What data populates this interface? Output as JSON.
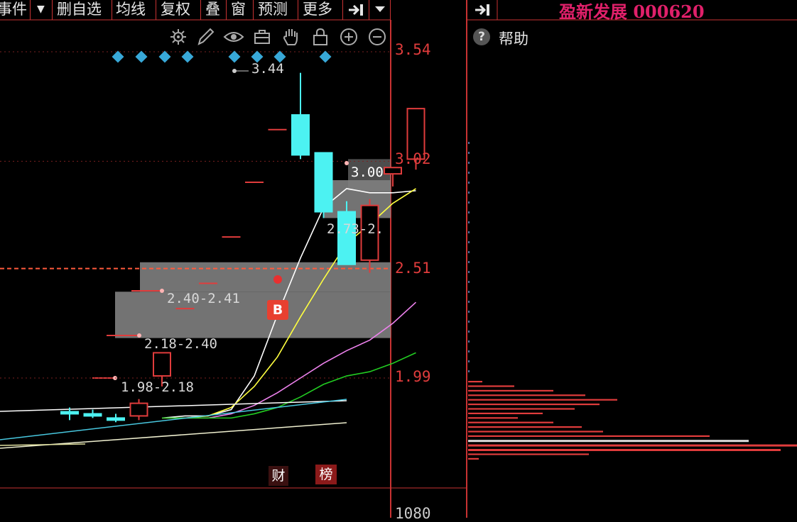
{
  "toolbar": {
    "items": [
      {
        "label": "事件"
      },
      {
        "label": "▼"
      },
      {
        "label": "删自选"
      },
      {
        "label": "均线"
      },
      {
        "label": "复权"
      },
      {
        "label": "叠"
      },
      {
        "label": "窗"
      },
      {
        "label": "预测"
      },
      {
        "label": "更多"
      }
    ]
  },
  "stock_title": {
    "name": "盈新发展",
    "code": "000620"
  },
  "help": {
    "label": "帮助",
    "icon": "question-icon"
  },
  "tools": [
    "settings-icon",
    "draw-pen-icon",
    "eye-icon",
    "toolbox-icon",
    "hand-icon",
    "lock-icon",
    "zoom-in-icon",
    "zoom-out-icon"
  ],
  "price_axis": {
    "labels": [
      "3.54",
      "3.02",
      "2.51",
      "1.99"
    ],
    "bottom_label": "1080"
  },
  "annotations": {
    "high_label": "3.44",
    "zone_1_label": "3.00",
    "zone_2_label": "2.73-2.",
    "zone_3_label": "2.40-2.41",
    "zone_4_label": "2.18-2.40",
    "zone_5_label": "1.98-2.18"
  },
  "tags": {
    "buy": "B",
    "finance": "财",
    "rank": "榜"
  },
  "colors": {
    "up": "#e03c3c",
    "down": "#4cf2f2",
    "ma5": "#ffffff",
    "ma10": "#ffff40",
    "ma20": "#ee82ee",
    "ma30": "#22cc22",
    "zone": "#808080",
    "title": "#e0206a"
  },
  "chart_data": {
    "type": "candlestick",
    "ylim": [
      1.7,
      3.6
    ],
    "candles": [
      {
        "open": 1.83,
        "high": 1.85,
        "low": 1.79,
        "close": 1.82
      },
      {
        "open": 1.82,
        "high": 1.84,
        "low": 1.8,
        "close": 1.81
      },
      {
        "open": 1.8,
        "high": 1.82,
        "low": 1.78,
        "close": 1.79
      },
      {
        "open": 1.81,
        "high": 1.89,
        "low": 1.79,
        "close": 1.87
      },
      {
        "open": 2.0,
        "high": 2.11,
        "low": 1.95,
        "close": 2.11
      },
      {
        "open": 2.32,
        "high": 2.32,
        "low": 2.32,
        "close": 2.32
      },
      {
        "open": 2.44,
        "high": 2.44,
        "low": 2.44,
        "close": 2.44
      },
      {
        "open": 2.66,
        "high": 2.66,
        "low": 2.66,
        "close": 2.66
      },
      {
        "open": 2.92,
        "high": 2.92,
        "low": 2.92,
        "close": 2.92
      },
      {
        "open": 3.17,
        "high": 3.17,
        "low": 3.17,
        "close": 3.17
      },
      {
        "open": 3.24,
        "high": 3.44,
        "low": 3.03,
        "close": 3.05
      },
      {
        "open": 3.06,
        "high": 3.06,
        "low": 2.75,
        "close": 2.78
      },
      {
        "open": 2.78,
        "high": 2.83,
        "low": 2.53,
        "close": 2.53
      },
      {
        "open": 2.55,
        "high": 2.84,
        "low": 2.49,
        "close": 2.81
      },
      {
        "open": 2.96,
        "high": 2.99,
        "low": 2.9,
        "close": 2.99
      },
      {
        "open": 3.03,
        "high": 3.27,
        "low": 2.98,
        "close": 3.27
      }
    ],
    "ma_series": [
      {
        "key": "ma5",
        "values": [
          1.8,
          1.81,
          1.81,
          1.84,
          2.0,
          2.29,
          2.56,
          2.8,
          2.89,
          2.87,
          2.87,
          2.88
        ]
      },
      {
        "key": "ma10",
        "values": [
          1.8,
          1.8,
          1.81,
          1.85,
          1.95,
          2.09,
          2.28,
          2.46,
          2.63,
          2.72,
          2.82,
          2.89
        ]
      },
      {
        "key": "ma20",
        "values": [
          1.8,
          1.8,
          1.8,
          1.82,
          1.86,
          1.92,
          1.99,
          2.06,
          2.12,
          2.17,
          2.25,
          2.35
        ]
      },
      {
        "key": "ma30",
        "values": [
          1.8,
          1.8,
          1.8,
          1.8,
          1.82,
          1.85,
          1.9,
          1.96,
          2.0,
          2.02,
          2.06,
          2.11
        ]
      }
    ],
    "zones": [
      {
        "low": 2.88,
        "high": 3.03,
        "label_key": "zone_1_label"
      },
      {
        "low": 2.75,
        "high": 2.93,
        "label_key": "zone_2_label"
      },
      {
        "low": 2.4,
        "high": 2.54,
        "label_key": "zone_3_label"
      },
      {
        "low": 2.18,
        "high": 2.4,
        "label_key": "zone_4_label"
      },
      {
        "low": 1.98,
        "high": 2.18,
        "label_key": "zone_5_label"
      }
    ],
    "support_levels": [
      3.54,
      3.02,
      2.51,
      1.99
    ],
    "volume_profile": [
      {
        "price": 2.0,
        "count": 20
      },
      {
        "price": 1.98,
        "count": 65
      },
      {
        "price": 1.96,
        "count": 120
      },
      {
        "price": 1.94,
        "count": 165
      },
      {
        "price": 1.92,
        "count": 210
      },
      {
        "price": 1.9,
        "count": 185
      },
      {
        "price": 1.88,
        "count": 150
      },
      {
        "price": 1.86,
        "count": 105
      },
      {
        "price": 1.84,
        "count": 70
      },
      {
        "price": 1.82,
        "count": 120
      },
      {
        "price": 1.8,
        "count": 160
      },
      {
        "price": 1.78,
        "count": 190
      },
      {
        "price": 1.76,
        "count": 340
      },
      {
        "price": 1.74,
        "count": 395
      },
      {
        "price": 1.72,
        "count": 465
      },
      {
        "price": 1.7,
        "count": 440
      },
      {
        "price": 1.68,
        "count": 170
      },
      {
        "price": 1.66,
        "count": 15
      }
    ]
  }
}
